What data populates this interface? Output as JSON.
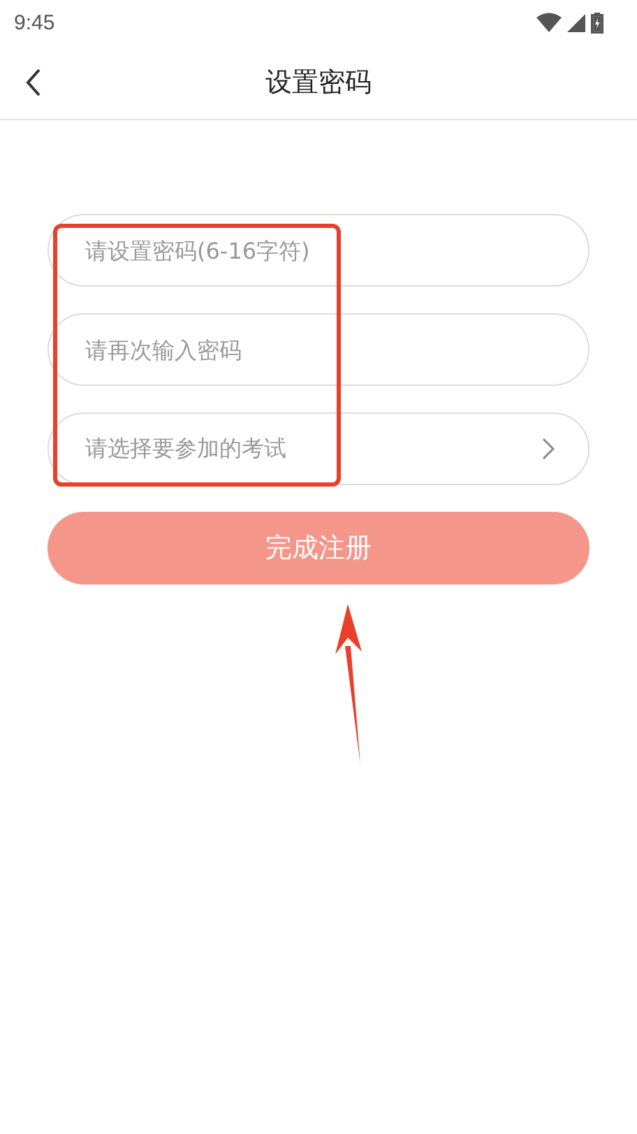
{
  "status_bar": {
    "time": "9:45"
  },
  "header": {
    "title": "设置密码"
  },
  "fields": [
    {
      "kind": "input",
      "placeholder": "请设置密码(6-16字符)"
    },
    {
      "kind": "input",
      "placeholder": "请再次输入密码"
    },
    {
      "kind": "select",
      "placeholder": "请选择要参加的考试"
    }
  ],
  "submit_button": {
    "label": "完成注册"
  }
}
